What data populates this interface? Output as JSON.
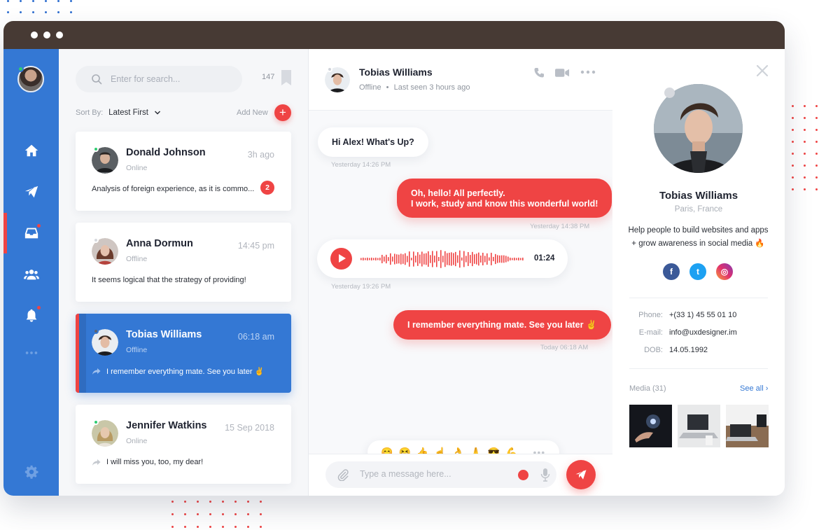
{
  "colors": {
    "accent_blue": "#3478d4",
    "accent_red": "#ef4444",
    "titlebar": "#473a34",
    "online": "#2ecc71"
  },
  "nav": {
    "items": [
      {
        "name": "home",
        "icon": "home-icon"
      },
      {
        "name": "send",
        "icon": "paper-plane-icon"
      },
      {
        "name": "inbox",
        "icon": "inbox-icon",
        "active": true
      },
      {
        "name": "contacts",
        "icon": "users-icon"
      },
      {
        "name": "notifications",
        "icon": "bell-icon"
      },
      {
        "name": "more",
        "icon": "more-dots-icon"
      },
      {
        "name": "settings",
        "icon": "gear-icon"
      }
    ]
  },
  "sidebar": {
    "search_placeholder": "Enter for search...",
    "count": "147",
    "sort_label": "Sort By:",
    "sort_value": "Latest First",
    "add_new_label": "Add New",
    "add_button": "+",
    "conversations": [
      {
        "name": "Donald Johnson",
        "time": "3h ago",
        "status": "Online",
        "preview": "Analysis of foreign experience, as it is commo...",
        "unread": "2"
      },
      {
        "name": "Anna Dormun",
        "time": "14:45 pm",
        "status": "Offline",
        "preview": "It seems logical that the strategy of providing!"
      },
      {
        "name": "Tobias Williams",
        "time": "06:18 am",
        "status": "Offline",
        "preview": "I remember everything mate. See you later ✌"
      },
      {
        "name": "Jennifer Watkins",
        "time": "15 Sep 2018",
        "status": "Online",
        "preview": "I will miss you, too, my dear!"
      }
    ]
  },
  "chat": {
    "name": "Tobias Williams",
    "status": "Offline",
    "separator": "•",
    "last_seen": "Last seen 3 hours ago",
    "messages": [
      {
        "text": "Hi Alex! What's Up?",
        "time": "Yesterday 14:26 PM"
      },
      {
        "line1": "Oh, hello! All perfectly.",
        "line2": "I work, study and know this wonderful world!",
        "time": "Yesterday 14:38 PM"
      },
      {
        "duration": "01:24",
        "time": "Yesterday 19:26 PM"
      },
      {
        "text": "I remember everything mate. See you later ✌",
        "time": "Today 06:18 AM"
      }
    ],
    "emojis": [
      "😊",
      "😆",
      "👍",
      "☝",
      "👌",
      "🙏",
      "😎",
      "💪"
    ],
    "emoji_more": "•••",
    "composer_placeholder": "Type a message here..."
  },
  "profile": {
    "name": "Tobias Williams",
    "location": "Paris, France",
    "bio": "Help people to build websites and apps + grow awareness in social media 🔥",
    "socials": [
      "f",
      "t",
      "◎"
    ],
    "phone_label": "Phone:",
    "phone": "+(33 1) 45 55 01 10",
    "email_label": "E-mail:",
    "email": "info@uxdesigner.im",
    "dob_label": "DOB:",
    "dob": "14.05.1992",
    "media_label": "Media (31)",
    "see_all": "See all ›"
  }
}
